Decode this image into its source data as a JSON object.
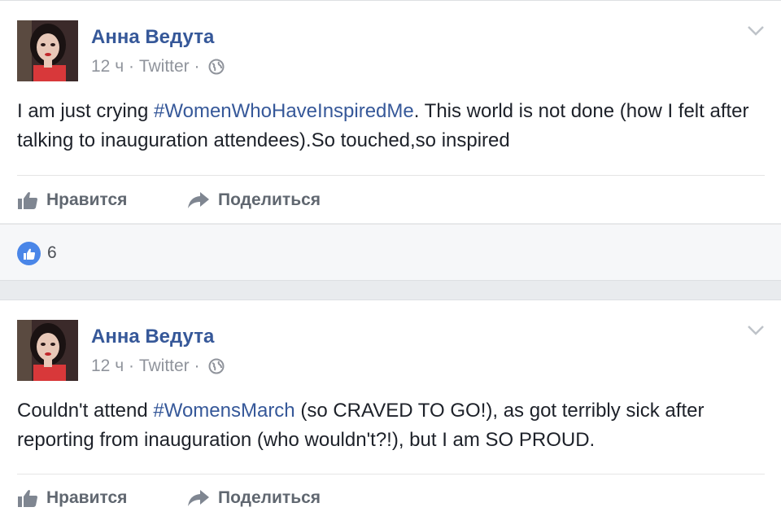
{
  "posts": [
    {
      "author": "Анна Ведута",
      "time": "12 ч",
      "source": "Twitter",
      "text_before": "I am just crying ",
      "hashtag": "#WomenWhoHaveInspiredMe",
      "text_after": ". This world is not done (how I felt after talking to inauguration attendees).So touched,so inspired",
      "like_label": "Нравится",
      "share_label": "Поделиться",
      "reactions": {
        "icon": "thumbs-up-icon",
        "count": "6"
      }
    },
    {
      "author": "Анна Ведута",
      "time": "12 ч",
      "source": "Twitter",
      "text_before": "Couldn't attend ",
      "hashtag": "#WomensMarch",
      "text_after": " (so CRAVED TO GO!), as got terribly sick after reporting from inauguration (who wouldn't?!), but I am SO PROUD.",
      "like_label": "Нравится",
      "share_label": "Поделиться"
    }
  ],
  "separator": " · ",
  "colors": {
    "link": "#365899",
    "meta": "#90949c",
    "action": "#606770",
    "like_badge": "#4a86e8",
    "background": "#e9ebee"
  }
}
